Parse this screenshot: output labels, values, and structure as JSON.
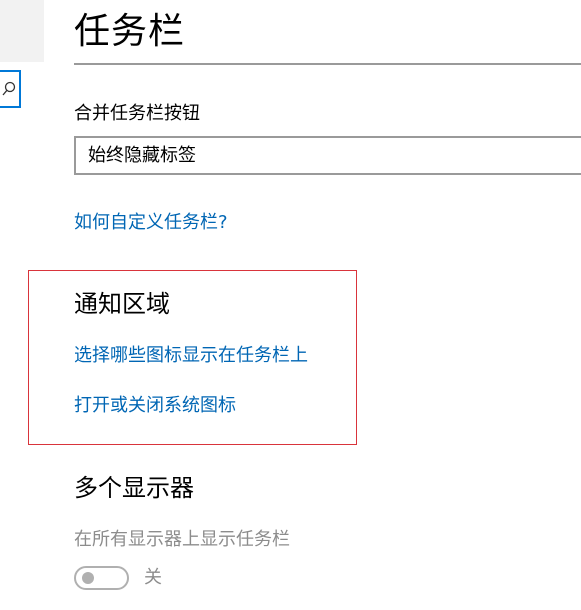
{
  "page": {
    "title": "任务栏"
  },
  "nav": {
    "search_icon": "search-icon"
  },
  "combine": {
    "label": "合并任务栏按钮",
    "selected_value": "始终隐藏标签"
  },
  "help_link": "如何自定义任务栏?",
  "notification_area": {
    "heading": "通知区域",
    "link_select_icons": "选择哪些图标显示在任务栏上",
    "link_system_icons": "打开或关闭系统图标"
  },
  "multi_display": {
    "heading": "多个显示器",
    "setting_label": "在所有显示器上显示任务栏",
    "toggle_state": "关"
  },
  "colors": {
    "link": "#0066b4",
    "accent": "#0078d7",
    "highlight_border": "#d9343b",
    "disabled_text": "#8c8c8c"
  }
}
